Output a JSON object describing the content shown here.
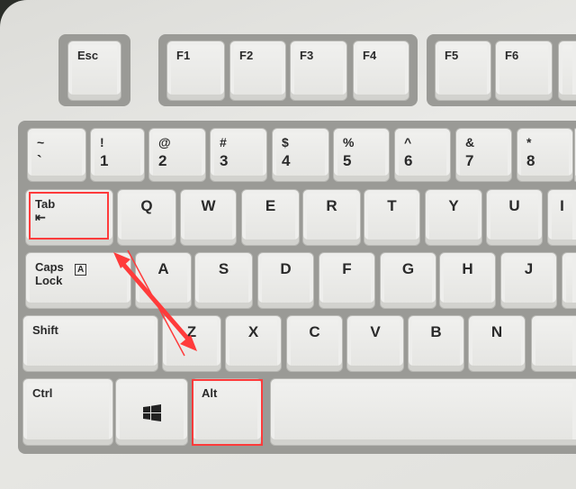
{
  "keys": [
    {
      "name": "esc",
      "top": "Esc"
    },
    {
      "name": "f1",
      "top": "F1"
    },
    {
      "name": "f2",
      "top": "F2"
    },
    {
      "name": "f3",
      "top": "F3"
    },
    {
      "name": "f4",
      "top": "F4"
    },
    {
      "name": "f5",
      "top": "F5"
    },
    {
      "name": "f6",
      "top": "F6"
    },
    {
      "name": "f7",
      "top": ""
    },
    {
      "name": "tilde",
      "top": "~",
      "bottom": "`"
    },
    {
      "name": "1",
      "top": "!",
      "bottom": "1"
    },
    {
      "name": "2",
      "top": "@",
      "bottom": "2"
    },
    {
      "name": "3",
      "top": "#",
      "bottom": "3"
    },
    {
      "name": "4",
      "top": "$",
      "bottom": "4"
    },
    {
      "name": "5",
      "top": "%",
      "bottom": "5"
    },
    {
      "name": "6",
      "top": "^",
      "bottom": "6"
    },
    {
      "name": "7",
      "top": "&",
      "bottom": "7"
    },
    {
      "name": "8",
      "top": "*",
      "bottom": "8"
    },
    {
      "name": "9",
      "top": ""
    },
    {
      "name": "tab",
      "top": "Tab",
      "bottom": "⇤"
    },
    {
      "name": "q",
      "top": "Q"
    },
    {
      "name": "w",
      "top": "W"
    },
    {
      "name": "e",
      "top": "E"
    },
    {
      "name": "r",
      "top": "R"
    },
    {
      "name": "t",
      "top": "T"
    },
    {
      "name": "y",
      "top": "Y"
    },
    {
      "name": "u",
      "top": "U"
    },
    {
      "name": "i",
      "top": "I"
    },
    {
      "name": "caps-lock",
      "top": "Caps\nLock",
      "bottom": "A"
    },
    {
      "name": "a",
      "top": "A"
    },
    {
      "name": "s",
      "top": "S"
    },
    {
      "name": "d",
      "top": "D"
    },
    {
      "name": "f",
      "top": "F"
    },
    {
      "name": "g",
      "top": "G"
    },
    {
      "name": "h",
      "top": "H"
    },
    {
      "name": "j",
      "top": "J"
    },
    {
      "name": "k",
      "top": ""
    },
    {
      "name": "shift",
      "top": "Shift"
    },
    {
      "name": "z",
      "top": "Z"
    },
    {
      "name": "x",
      "top": "X"
    },
    {
      "name": "c",
      "top": "C"
    },
    {
      "name": "v",
      "top": "V"
    },
    {
      "name": "b",
      "top": "B"
    },
    {
      "name": "n",
      "top": "N"
    },
    {
      "name": "m",
      "top": ""
    },
    {
      "name": "ctrl",
      "top": "Ctrl"
    },
    {
      "name": "windows",
      "top": ""
    },
    {
      "name": "alt",
      "top": "Alt"
    },
    {
      "name": "space",
      "top": ""
    }
  ],
  "annotations": {
    "highlight_color": "#ff3b3b",
    "highlighted_keys": [
      "Tab",
      "Alt"
    ],
    "arrow": "double-headed arrow between Tab and Alt"
  }
}
